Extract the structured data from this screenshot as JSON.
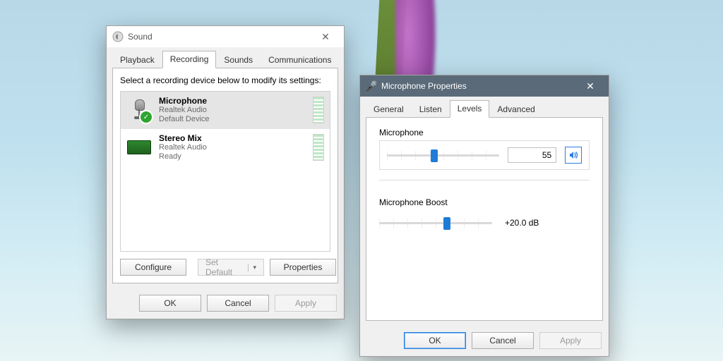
{
  "sound": {
    "title": "Sound",
    "tabs": [
      "Playback",
      "Recording",
      "Sounds",
      "Communications"
    ],
    "active_tab": 1,
    "instruction": "Select a recording device below to modify its settings:",
    "devices": [
      {
        "name": "Microphone",
        "vendor": "Realtek Audio",
        "status": "Default Device",
        "selected": true,
        "icon": "microphone-icon",
        "checked": true
      },
      {
        "name": "Stereo Mix",
        "vendor": "Realtek Audio",
        "status": "Ready",
        "selected": false,
        "icon": "soundcard-icon",
        "checked": false
      }
    ],
    "configure": "Configure",
    "set_default": "Set Default",
    "properties": "Properties",
    "ok": "OK",
    "cancel": "Cancel",
    "apply": "Apply"
  },
  "props": {
    "title": "Microphone Properties",
    "tabs": [
      "General",
      "Listen",
      "Levels",
      "Advanced"
    ],
    "active_tab": 2,
    "mic_label": "Microphone",
    "mic_value": "55",
    "mic_percent": 42,
    "boost_label": "Microphone Boost",
    "boost_value": "+20.0 dB",
    "boost_percent": 60,
    "ok": "OK",
    "cancel": "Cancel",
    "apply": "Apply"
  }
}
